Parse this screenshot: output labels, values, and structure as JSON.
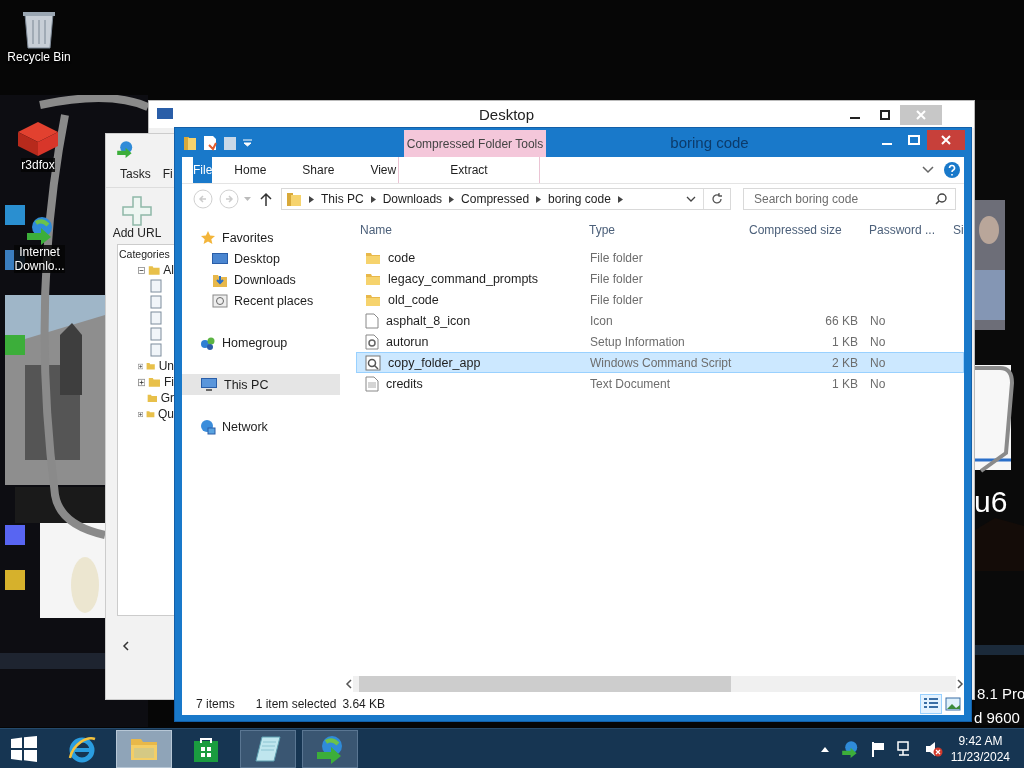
{
  "desktop_icons": [
    {
      "label": "Recycle Bin",
      "kind": "recycle"
    },
    {
      "label": "r3dfox",
      "kind": "r3dfox"
    },
    {
      "label": "Internet Downlo...",
      "kind": "idm"
    }
  ],
  "background_window": {
    "title": "Desktop"
  },
  "download_manager": {
    "menu": [
      "Tasks",
      "Fi"
    ],
    "add_button": "Add URL",
    "categories_label": "Categories",
    "tree": [
      {
        "label": "Al",
        "expanded": true
      },
      {
        "label": "Un",
        "expanded": false
      },
      {
        "label": "Fi",
        "expanded": false
      },
      {
        "label": "Gr"
      },
      {
        "label": "Qu",
        "expanded": false
      }
    ]
  },
  "overlay_texts": {
    "handwriting": "u6",
    "edition": "8.1 Pro",
    "build": "d 9600"
  },
  "explorer": {
    "title": "boring code",
    "context_tab": "Compressed Folder Tools",
    "ribbon_tabs": [
      {
        "label": "File",
        "kind": "file"
      },
      {
        "label": "Home",
        "kind": "tab"
      },
      {
        "label": "Share",
        "kind": "tab"
      },
      {
        "label": "View",
        "kind": "tab"
      },
      {
        "label": "Extract",
        "kind": "context"
      }
    ],
    "breadcrumb": [
      "This PC",
      "Downloads",
      "Compressed",
      "boring code"
    ],
    "search": {
      "placeholder": "Search boring code"
    },
    "nav": [
      {
        "label": "Favorites",
        "kind": "favorites",
        "selected": false,
        "children": [
          {
            "label": "Desktop",
            "kind": "desktop",
            "selected": false
          },
          {
            "label": "Downloads",
            "kind": "downloads",
            "selected": false
          },
          {
            "label": "Recent places",
            "kind": "recent",
            "selected": false
          }
        ]
      },
      {
        "label": "Homegroup",
        "kind": "homegroup",
        "selected": false
      },
      {
        "label": "This PC",
        "kind": "pc",
        "selected": true
      },
      {
        "label": "Network",
        "kind": "network",
        "selected": false
      }
    ],
    "columns": [
      "Name",
      "Type",
      "Compressed size",
      "Password ...",
      "Si"
    ],
    "rows": [
      {
        "name": "code",
        "type": "File folder",
        "kind": "folder",
        "selected": false
      },
      {
        "name": "legacy_command_prompts",
        "type": "File folder",
        "kind": "folder",
        "selected": false
      },
      {
        "name": "old_code",
        "type": "File folder",
        "kind": "folder",
        "selected": false
      },
      {
        "name": "asphalt_8_icon",
        "type": "Icon",
        "size": "66 KB",
        "password": "No",
        "kind": "file",
        "selected": false
      },
      {
        "name": "autorun",
        "type": "Setup Information",
        "size": "1 KB",
        "password": "No",
        "kind": "setup",
        "selected": false
      },
      {
        "name": "copy_folder_app",
        "type": "Windows Command Script",
        "size": "2 KB",
        "password": "No",
        "kind": "script",
        "selected": true
      },
      {
        "name": "credits",
        "type": "Text Document",
        "size": "1 KB",
        "password": "No",
        "kind": "text",
        "selected": false
      }
    ],
    "status": {
      "count": "7 items",
      "selection": "1 item selected",
      "size": "3.64 KB"
    },
    "views": [
      {
        "kind": "details",
        "selected": true
      },
      {
        "kind": "thumbs",
        "selected": false
      }
    ]
  },
  "taskbar": {
    "apps": [
      {
        "kind": "ie",
        "running": false,
        "selected": false
      },
      {
        "kind": "explorer",
        "running": true,
        "selected": true
      },
      {
        "kind": "store",
        "running": false,
        "selected": false
      },
      {
        "kind": "notepad",
        "running": true,
        "selected": false
      },
      {
        "kind": "idm",
        "running": true,
        "selected": false
      }
    ],
    "time": "9:42 AM",
    "date": "11/23/2024"
  }
}
